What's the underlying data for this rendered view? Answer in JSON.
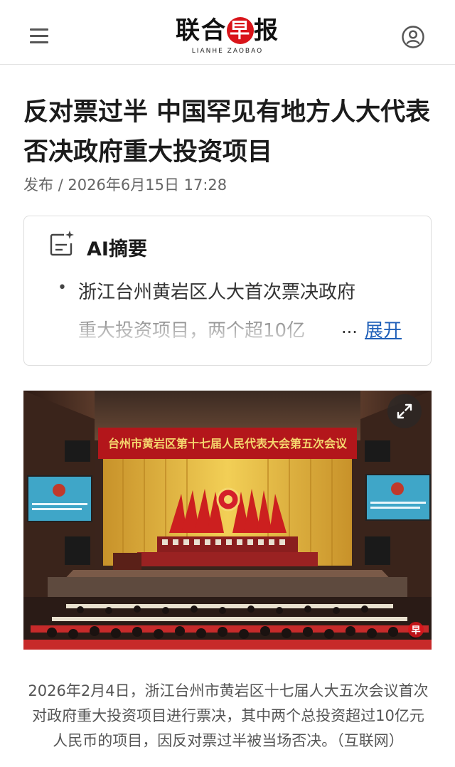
{
  "header": {
    "logo_cn_part1": "联合",
    "logo_cn_badge": "早",
    "logo_cn_part2": "报",
    "logo_en": "LIANHE ZAOBAO",
    "menu_icon": "hamburger-menu-icon",
    "user_icon": "user-account-icon"
  },
  "article": {
    "title": "反对票过半 中国罕见有地方人大代表否决政府重大投资项目",
    "published": "发布 / 2026年6月15日 17:28"
  },
  "ai_summary": {
    "title": "AI摘要",
    "bullet": "•",
    "line1": "浙江台州黄岩区人大首次票决政府",
    "line2": "重大投资项目，两个超10亿",
    "ellipsis": "...",
    "expand_label": "展开"
  },
  "photo": {
    "banner_text": "台州市黄岩区第十七届人民代表大会第五次会议",
    "screen_text_line1": "台州市黄岩区第十七届人民代表大会",
    "screen_text_line2": "第五次会议第二次全体会议",
    "watermark": "早",
    "expand_icon": "fullscreen-expand-icon"
  },
  "caption": "2026年2月4日，浙江台州市黄岩区十七届人大五次会议首次对政府重大投资项目进行票决，其中两个总投资超过10亿元人民币的项目，因反对票过半被当场否决。（互联网）",
  "colors": {
    "brand_red": "#d9141a",
    "link_blue": "#1f5fb8",
    "banner_red": "#b3161b",
    "stage_gold": "#e6b93c"
  }
}
